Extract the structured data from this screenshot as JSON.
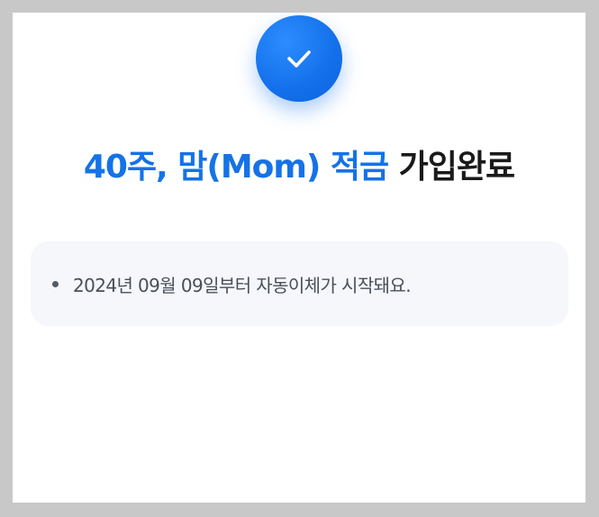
{
  "completion": {
    "icon": "check-icon",
    "accent_color": "#1572e8",
    "title_product": "40주, 맘(Mom) 적금",
    "title_suffix": " 가입완료"
  },
  "notice": {
    "items": [
      {
        "text": "2024년 09월 09일부터 자동이체가 시작돼요."
      }
    ]
  }
}
